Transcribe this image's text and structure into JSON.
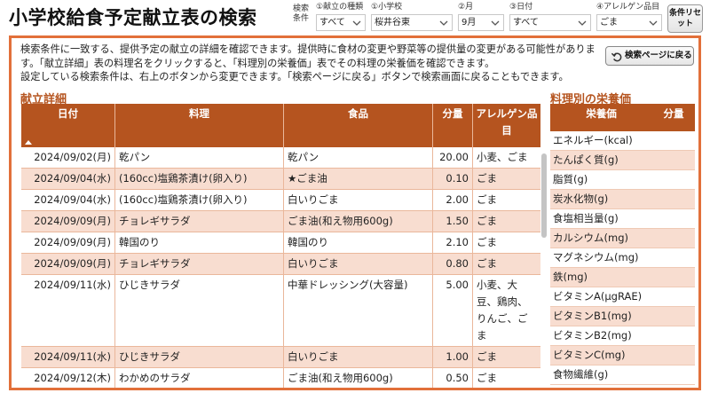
{
  "header": {
    "title": "小学校給食予定献立表の検索",
    "conditions_label": "検索条件",
    "filters": [
      {
        "label": "①献立の種類",
        "value": "すべて"
      },
      {
        "label": "①小学校",
        "value": "桜井谷東"
      },
      {
        "label": "②月",
        "value": "9月"
      },
      {
        "label": "③日付",
        "value": "すべて"
      },
      {
        "label": "④アレルゲン品目",
        "value": "ごま"
      }
    ],
    "reset_label": "条件リセット"
  },
  "description": [
    "検索条件に一致する、提供予定の献立の詳細を確認できます。提供時に食材の変更や野菜等の提供量の変更がある可能性があります。「献立詳細」表の料理名をクリックすると、「料理別の栄養価」表でその料理の栄養価を確認できます。",
    "設定している検索条件は、右上のボタンから変更できます。「検索ページに戻る」ボタンで検索画面に戻ることもできます。"
  ],
  "back_button": "検索ページに戻る",
  "menu": {
    "title": "献立詳細",
    "headers": {
      "date": "日付",
      "dish": "料理",
      "food": "食品",
      "qty": "分量",
      "allergen": "アレルゲン品目"
    },
    "rows": [
      {
        "date": "2024/09/02(月)",
        "dish": "乾パン",
        "food": "乾パン",
        "qty": "20.00",
        "allergen": "小麦、ごま"
      },
      {
        "date": "2024/09/04(水)",
        "dish": "(160cc)塩鶏茶漬け(卵入り)",
        "food": "★ごま油",
        "qty": "0.10",
        "allergen": "ごま"
      },
      {
        "date": "2024/09/04(水)",
        "dish": "(160cc)塩鶏茶漬け(卵入り)",
        "food": "白いりごま",
        "qty": "2.00",
        "allergen": "ごま"
      },
      {
        "date": "2024/09/09(月)",
        "dish": "チョレギサラダ",
        "food": "ごま油(和え物用600g)",
        "qty": "1.50",
        "allergen": "ごま"
      },
      {
        "date": "2024/09/09(月)",
        "dish": "韓国のり",
        "food": "韓国のり",
        "qty": "2.10",
        "allergen": "ごま"
      },
      {
        "date": "2024/09/09(月)",
        "dish": "チョレギサラダ",
        "food": "白いりごま",
        "qty": "0.80",
        "allergen": "ごま"
      },
      {
        "date": "2024/09/11(水)",
        "dish": "ひじきサラダ",
        "food": "中華ドレッシング(大容量)",
        "qty": "5.00",
        "allergen": "小麦、大豆、鶏肉、りんご、ごま"
      },
      {
        "date": "2024/09/11(水)",
        "dish": "ひじきサラダ",
        "food": "白いりごま",
        "qty": "1.00",
        "allergen": "ごま"
      },
      {
        "date": "2024/09/12(木)",
        "dish": "わかめのサラダ",
        "food": "ごま油(和え物用600g)",
        "qty": "0.50",
        "allergen": "ごま"
      }
    ]
  },
  "nutrition": {
    "title": "料理別の栄養価",
    "headers": {
      "name": "栄養価",
      "amount": "分量"
    },
    "rows": [
      "エネルギー(kcal)",
      "たんぱく質(g)",
      "脂質(g)",
      "炭水化物(g)",
      "食塩相当量(g)",
      "カルシウム(mg)",
      "マグネシウム(mg)",
      "鉄(mg)",
      "ビタミンA(μgRAE)",
      "ビタミンB1(mg)",
      "ビタミンB2(mg)",
      "ビタミンC(mg)",
      "食物繊維(g)"
    ]
  },
  "colors": {
    "accent": "#b5541f",
    "frame": "#e2703a",
    "row_alt": "#f8ddd0"
  }
}
